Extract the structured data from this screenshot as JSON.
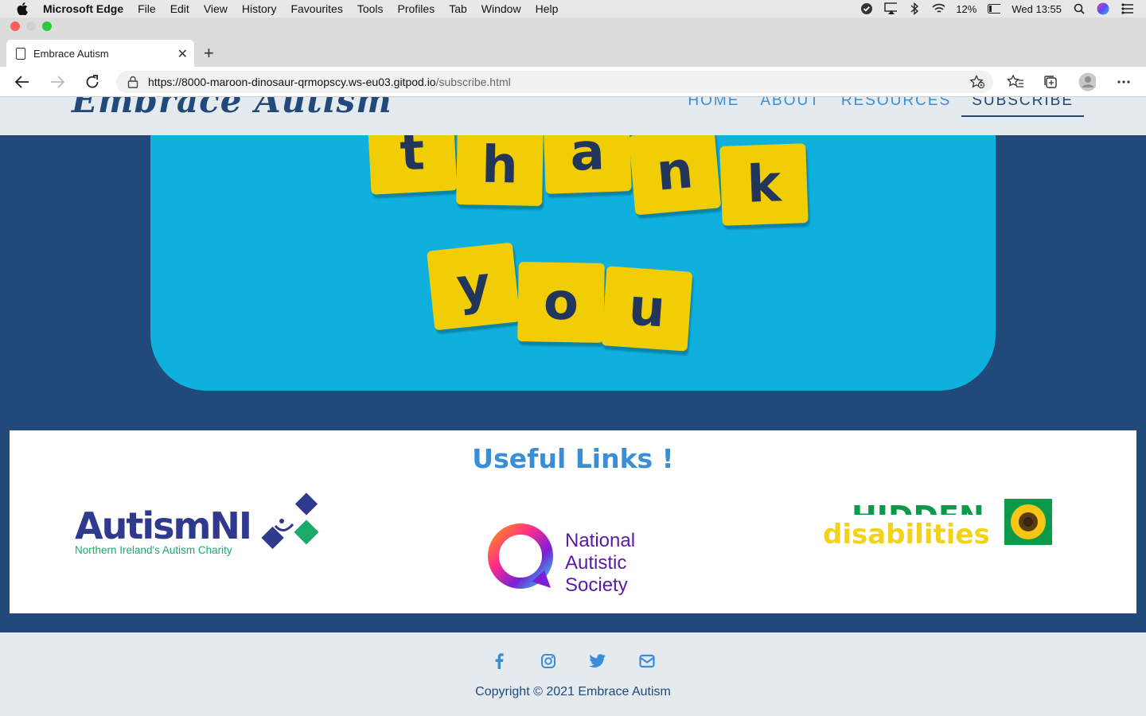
{
  "menubar": {
    "app_name": "Microsoft Edge",
    "items": [
      "File",
      "Edit",
      "View",
      "History",
      "Favourites",
      "Tools",
      "Profiles",
      "Tab",
      "Window",
      "Help"
    ],
    "battery": "12%",
    "clock": "Wed 13:55"
  },
  "browser": {
    "tab_title": "Embrace Autism",
    "url_host": "https://8000-maroon-dinosaur-qrmopscy.ws-eu03.gitpod.io",
    "url_path": "/subscribe.html"
  },
  "site": {
    "logo": "Embrace Autism",
    "nav": [
      {
        "label": "HOME"
      },
      {
        "label": "ABOUT"
      },
      {
        "label": "RESOURCES"
      },
      {
        "label": "SUBSCRIBE",
        "active": true
      }
    ],
    "hero_tiles_row1": [
      "t",
      "h",
      "a",
      "n",
      "k"
    ],
    "hero_tiles_row2": [
      "y",
      "o",
      "u"
    ],
    "links_title": "Useful Links !",
    "partners": {
      "autism_ni": {
        "name": "AutismNI",
        "tagline": "Northern Ireland's Autism Charity"
      },
      "nas": {
        "line1": "National",
        "line2": "Autistic",
        "line3": "Society"
      },
      "hidden": {
        "line1": "HIDDEN",
        "line2": "disabilities"
      }
    },
    "footer": {
      "social_icons": [
        "facebook-icon",
        "instagram-icon",
        "twitter-icon",
        "email-icon"
      ],
      "copyright": "Copyright © 2021 Embrace Autism"
    }
  },
  "colors": {
    "navy": "#21497a",
    "link_blue": "#3a8ed6",
    "hero_blue": "#0fb0de",
    "tile_yellow": "#f1cd05",
    "footer_bg": "#e5eaef"
  }
}
